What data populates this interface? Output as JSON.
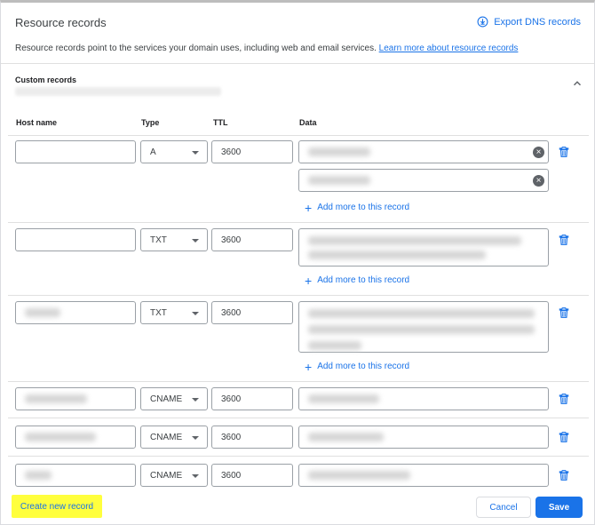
{
  "header": {
    "title": "Resource records",
    "export_label": "Export DNS records",
    "description": "Resource records point to the services your domain uses, including web and email services.",
    "learn_more": "Learn more about resource records"
  },
  "section": {
    "title": "Custom records"
  },
  "columns": {
    "host": "Host name",
    "type": "Type",
    "ttl": "TTL",
    "data": "Data"
  },
  "records": [
    {
      "type": "A",
      "ttl": "3600"
    },
    {
      "type": "TXT",
      "ttl": "3600"
    },
    {
      "type": "TXT",
      "ttl": "3600"
    },
    {
      "type": "CNAME",
      "ttl": "3600"
    },
    {
      "type": "CNAME",
      "ttl": "3600"
    },
    {
      "type": "CNAME",
      "ttl": "3600"
    }
  ],
  "add_more_label": "Add more to this record",
  "footer": {
    "create": "Create new record",
    "cancel": "Cancel",
    "save": "Save"
  },
  "colors": {
    "accent": "#1a73e8",
    "highlight": "#ffff3d"
  },
  "icons": [
    "export-icon",
    "chevron-up-icon",
    "clear-icon",
    "trash-icon",
    "plus-icon",
    "dropdown-arrow-icon"
  ]
}
